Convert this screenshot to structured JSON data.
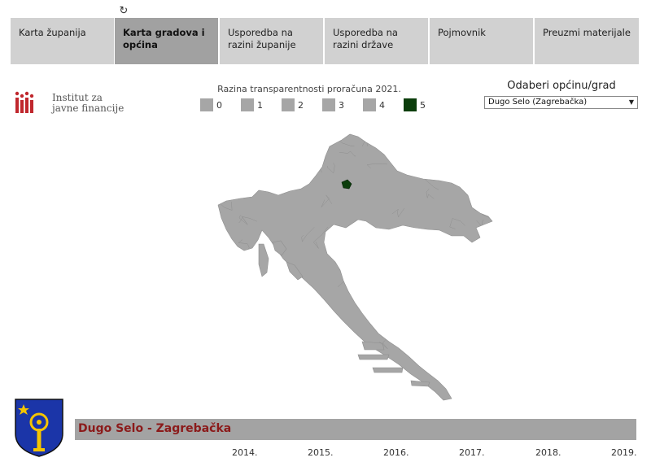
{
  "tabs": [
    {
      "label": "Karta županija",
      "active": false
    },
    {
      "label": "Karta gradova i općina",
      "active": true
    },
    {
      "label": "Usporedba na razini županije",
      "active": false
    },
    {
      "label": "Usporedba na razini države",
      "active": false
    },
    {
      "label": "Pojmovnik",
      "active": false
    },
    {
      "label": "Preuzmi materijale",
      "active": false
    }
  ],
  "logo": {
    "line1": "Institut za",
    "line2": "javne financije",
    "color": "#c0272d"
  },
  "legend": {
    "title": "Razina transparentnosti proračuna 2021.",
    "items": [
      {
        "label": "0",
        "color": "#a6a6a6"
      },
      {
        "label": "1",
        "color": "#a6a6a6"
      },
      {
        "label": "2",
        "color": "#a6a6a6"
      },
      {
        "label": "3",
        "color": "#a6a6a6"
      },
      {
        "label": "4",
        "color": "#a6a6a6"
      },
      {
        "label": "5",
        "color": "#0b3d0b"
      }
    ]
  },
  "selector": {
    "title": "Odaberi općinu/grad",
    "value": "Dugo Selo (Zagrebačka)"
  },
  "map": {
    "base_color": "#a6a6a6",
    "border_color": "#8f8f8f",
    "highlight_color": "#0b3d0b",
    "highlight_level": 5
  },
  "selected": {
    "name": "Dugo Selo - Zagrebačka",
    "name_color": "#8b1a1a"
  },
  "years": [
    "2014.",
    "2015.",
    "2016.",
    "2017.",
    "2018.",
    "2019."
  ]
}
